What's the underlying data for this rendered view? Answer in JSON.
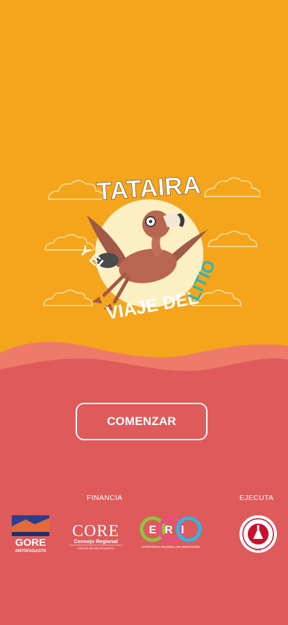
{
  "colors": {
    "top_background": "#F4A51C",
    "bottom_background": "#DE5A5B",
    "wave_light": "#EE7A6A",
    "button_border": "#FFFFFF",
    "title_white": "#FFFFFF",
    "title_accent": "#2FB6B0",
    "sun": "#FCEFC4"
  },
  "logo": {
    "line1": "TATAIRA",
    "line2": "Y EL",
    "line3": "VIAJE DEL",
    "line3_accent": "LITIO",
    "character": "flamingo-with-goggles"
  },
  "start_button": {
    "label": "COMENZAR"
  },
  "footer": {
    "financia_label": "FINANCIA",
    "ejecuta_label": "EJECUTA",
    "sponsors": [
      {
        "name": "GORE",
        "subtitle": "ANTOFAGASTA"
      },
      {
        "name": "CORE",
        "subtitle": "Consejo Regional",
        "tagline": "REGIÓN DE ANTOFAGASTA"
      },
      {
        "name": "ERI",
        "subtitle": "ESTRATEGIA REGIONAL DE INNOVACIÓN"
      },
      {
        "name": "UCN",
        "subtitle": "UNIVERSIDAD CATÓLICA DEL NORTE"
      }
    ]
  }
}
